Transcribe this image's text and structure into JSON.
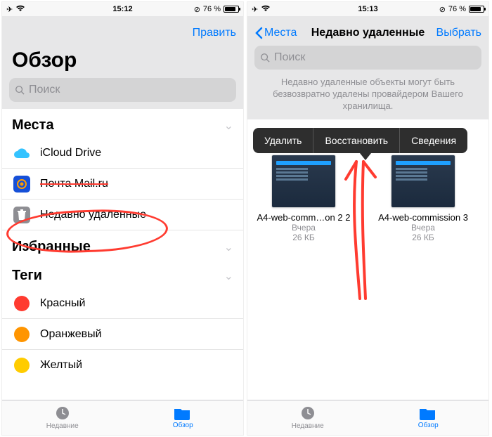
{
  "left": {
    "status": {
      "time": "15:12",
      "battery": "76 %",
      "airplane": "✈︎",
      "wifi": "wifi"
    },
    "nav": {
      "edit": "Править"
    },
    "title": "Обзор",
    "search_placeholder": "Поиск",
    "section_places": "Места",
    "places": [
      {
        "icon": "icloud",
        "label": "iCloud Drive"
      },
      {
        "icon": "mailru",
        "label": "Почта Mail.ru"
      },
      {
        "icon": "trash",
        "label": "Недавно удаленные"
      }
    ],
    "section_favorites": "Избранные",
    "section_tags": "Теги",
    "tags": [
      {
        "color": "#ff3b30",
        "label": "Красный"
      },
      {
        "color": "#ff9500",
        "label": "Оранжевый"
      },
      {
        "color": "#ffcc00",
        "label": "Желтый"
      }
    ],
    "tabbar": {
      "recent": "Недавние",
      "browse": "Обзор"
    }
  },
  "right": {
    "status": {
      "time": "15:13",
      "battery": "76 %"
    },
    "nav": {
      "back": "Места",
      "title": "Недавно удаленные",
      "select": "Выбрать"
    },
    "search_placeholder": "Поиск",
    "note": "Недавно удаленные объекты могут быть безвозвратно удалены провайдером Вашего хранилища.",
    "context_menu": {
      "delete": "Удалить",
      "restore": "Восстановить",
      "details": "Сведения"
    },
    "files": [
      {
        "name": "A4-web-comm…on 2 2",
        "when": "Вчера",
        "size": "26 КБ"
      },
      {
        "name": "A4-web-commission 3",
        "when": "Вчера",
        "size": "26 КБ"
      }
    ],
    "tabbar": {
      "recent": "Недавние",
      "browse": "Обзор"
    }
  }
}
